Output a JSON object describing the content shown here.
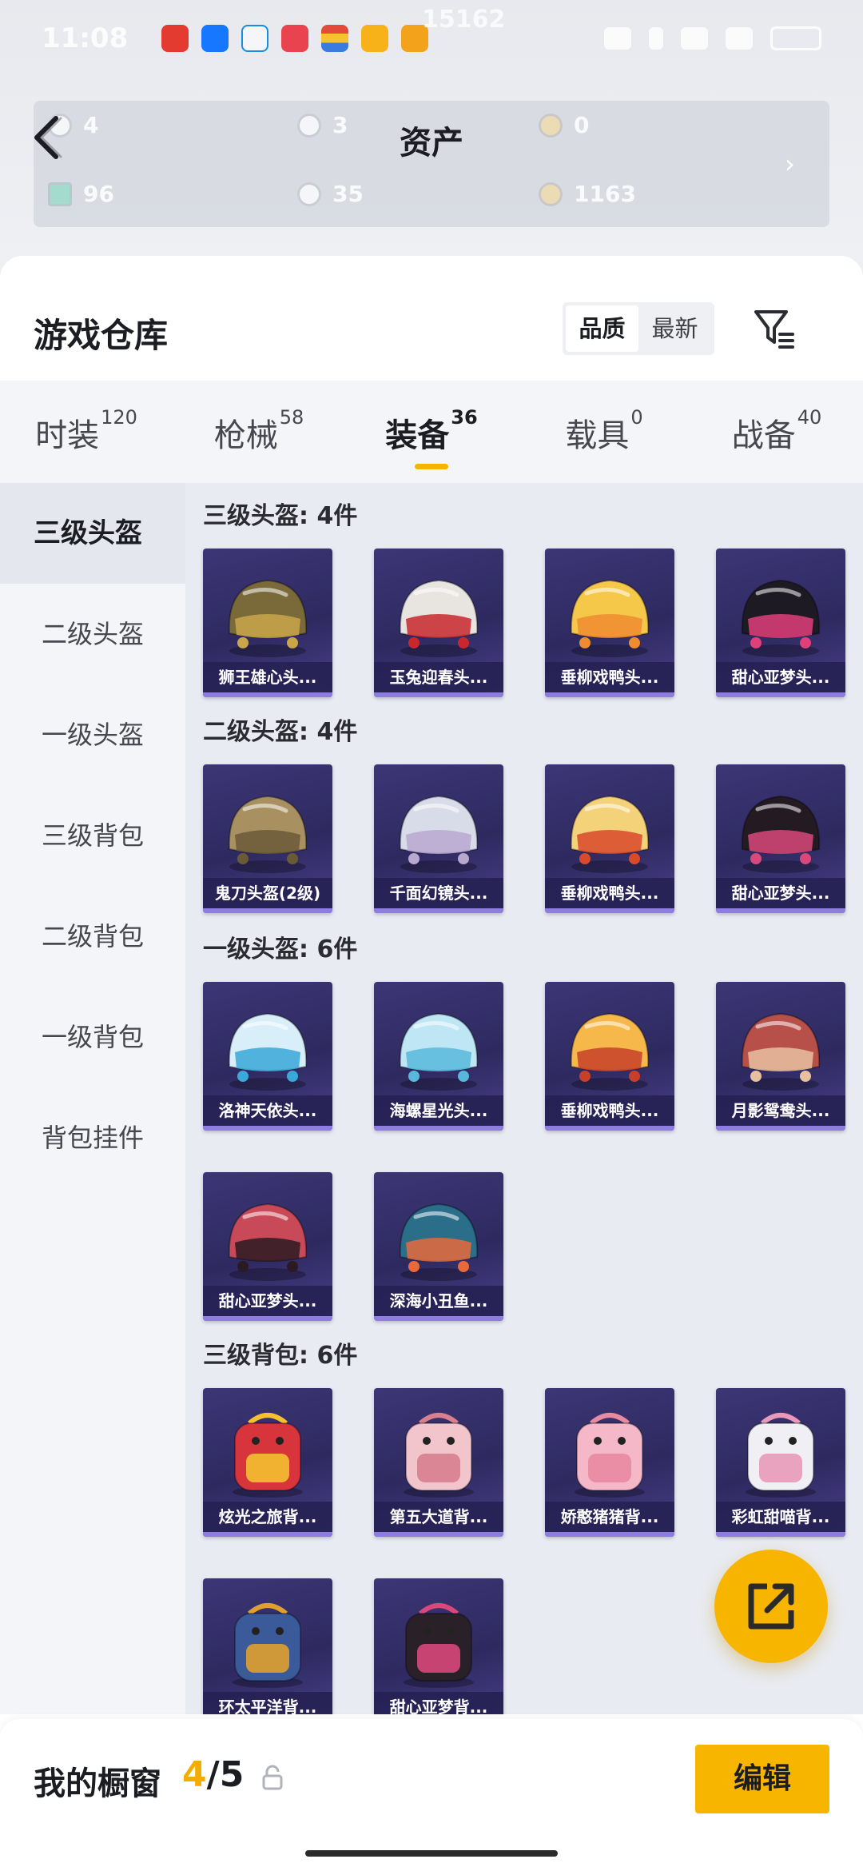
{
  "status_bar": {
    "time": "11:08",
    "battery": ""
  },
  "header": {
    "title": "资产",
    "blurred_user_line": "",
    "blurred_number": "15162",
    "assets": [
      {
        "value": "4"
      },
      {
        "value": "3"
      },
      {
        "value": "0"
      },
      {
        "value": "96"
      },
      {
        "value": "35"
      },
      {
        "value": "1163"
      }
    ]
  },
  "warehouse": {
    "title": "游戏仓库",
    "sort_options": [
      {
        "label": "品质",
        "active": true
      },
      {
        "label": "最新",
        "active": false
      }
    ]
  },
  "tabs": [
    {
      "label": "时装",
      "count": "120",
      "active": false
    },
    {
      "label": "枪械",
      "count": "58",
      "active": false
    },
    {
      "label": "装备",
      "count": "36",
      "active": true
    },
    {
      "label": "载具",
      "count": "0",
      "active": false
    },
    {
      "label": "战备",
      "count": "40",
      "active": false
    }
  ],
  "categories": [
    {
      "label": "三级头盔",
      "active": true
    },
    {
      "label": "二级头盔",
      "active": false
    },
    {
      "label": "一级头盔",
      "active": false
    },
    {
      "label": "三级背包",
      "active": false
    },
    {
      "label": "二级背包",
      "active": false
    },
    {
      "label": "一级背包",
      "active": false
    },
    {
      "label": "背包挂件",
      "active": false
    }
  ],
  "sections": [
    {
      "title": "三级头盔: 4件",
      "items": [
        {
          "name": "狮王雄心头...",
          "icon": "helmet-lion-icon",
          "color": "#7a6a3a",
          "accent": "#c9a64a"
        },
        {
          "name": "玉兔迎春头...",
          "icon": "helmet-rabbit-icon",
          "color": "#e8e4e0",
          "accent": "#c8282d"
        },
        {
          "name": "垂柳戏鸭头...",
          "icon": "helmet-duck-icon",
          "color": "#f5c84a",
          "accent": "#f08c30"
        },
        {
          "name": "甜心亚梦头...",
          "icon": "helmet-sweetheart-icon",
          "color": "#1e1a24",
          "accent": "#e0407a"
        }
      ]
    },
    {
      "title": "二级头盔: 4件",
      "items": [
        {
          "name": "鬼刀头盔(2级)",
          "icon": "helmet-ghostblade-icon",
          "color": "#a89060",
          "accent": "#6b5a38"
        },
        {
          "name": "千面幻镜头...",
          "icon": "helmet-mirror-icon",
          "color": "#d8dce8",
          "accent": "#b8a8d0"
        },
        {
          "name": "垂柳戏鸭头...",
          "icon": "helmet-duck-icon",
          "color": "#f4d27a",
          "accent": "#d84a2a"
        },
        {
          "name": "甜心亚梦头...",
          "icon": "helmet-sweetheart-icon",
          "color": "#241a22",
          "accent": "#d8487a"
        }
      ]
    },
    {
      "title": "一级头盔: 6件",
      "items": [
        {
          "name": "洛神天依头...",
          "icon": "helmet-luoshen-icon",
          "color": "#d8eef8",
          "accent": "#3aa8d8"
        },
        {
          "name": "海螺星光头...",
          "icon": "helmet-conch-icon",
          "color": "#bfe6f4",
          "accent": "#58b8dc"
        },
        {
          "name": "垂柳戏鸭头...",
          "icon": "helmet-duck-icon",
          "color": "#f6b84a",
          "accent": "#c8402a"
        },
        {
          "name": "月影鸳鸯头...",
          "icon": "helmet-moonshadow-icon",
          "color": "#b8504a",
          "accent": "#e8c0a0"
        },
        {
          "name": "甜心亚梦头...",
          "icon": "helmet-sweetheart-icon",
          "color": "#c84a58",
          "accent": "#2a1a22"
        },
        {
          "name": "深海小丑鱼...",
          "icon": "helmet-clownfish-icon",
          "color": "#2a6e8a",
          "accent": "#e86a3a"
        }
      ]
    },
    {
      "title": "三级背包: 6件",
      "items": [
        {
          "name": "炫光之旅背...",
          "icon": "backpack-dino-icon",
          "color": "#d8343c",
          "accent": "#f4c030"
        },
        {
          "name": "第五大道背...",
          "icon": "backpack-quilted-icon",
          "color": "#f2c4cc",
          "accent": "#d8808e"
        },
        {
          "name": "娇憨猪猪背...",
          "icon": "backpack-piggy-icon",
          "color": "#f4b8c8",
          "accent": "#e88aa0"
        },
        {
          "name": "彩虹甜喵背...",
          "icon": "backpack-rainbow-cat-icon",
          "color": "#f0f0f4",
          "accent": "#e89ab8"
        },
        {
          "name": "环太平洋背...",
          "icon": "backpack-mech-icon",
          "color": "#3a5a9a",
          "accent": "#e0a030"
        },
        {
          "name": "甜心亚梦背...",
          "icon": "backpack-sweetheart-icon",
          "color": "#2a2028",
          "accent": "#d8487a"
        }
      ]
    }
  ],
  "showcase": {
    "label": "我的橱窗",
    "current": "4",
    "total": "/5",
    "edit_label": "编辑"
  }
}
